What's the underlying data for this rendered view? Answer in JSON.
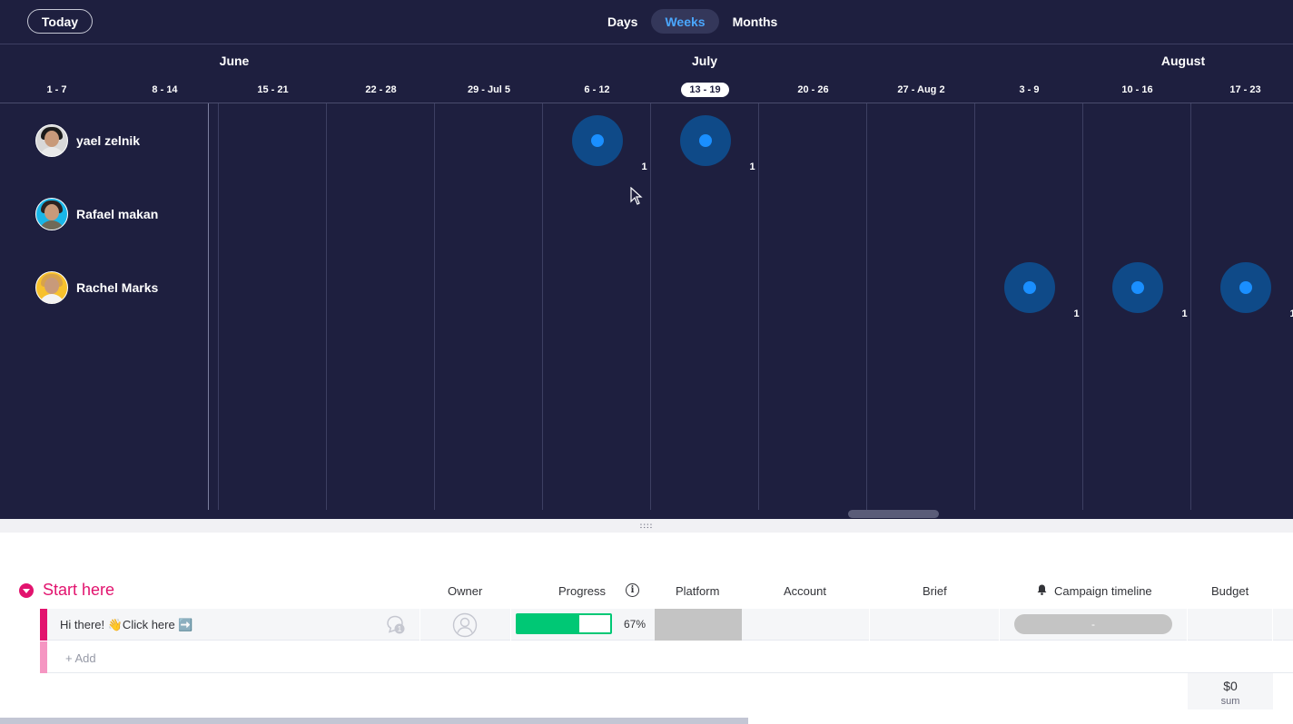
{
  "toolbar": {
    "today_label": "Today",
    "scales": [
      {
        "label": "Days",
        "active": false
      },
      {
        "label": "Weeks",
        "active": true
      },
      {
        "label": "Months",
        "active": false
      }
    ]
  },
  "months": [
    "June",
    "July",
    "August"
  ],
  "weeks": [
    "1 - 7",
    "8 - 14",
    "15 - 21",
    "22 - 28",
    "29 - Jul 5",
    "6 - 12",
    "13 - 19",
    "20 - 26",
    "27 - Aug 2",
    "3 - 9",
    "10 - 16",
    "17 - 23"
  ],
  "current_week": "13 - 19",
  "people": [
    {
      "name": "yael zelnik",
      "avatar": "avatar-woman-dark-hair",
      "hair": "#1b1b1b",
      "shirt": "#e9e9e9",
      "bg": "#d8d8d8"
    },
    {
      "name": "Rafael makan",
      "avatar": "avatar-man-beard",
      "hair": "#2b2220",
      "shirt": "#6f6a58",
      "bg": "#19b6e8"
    },
    {
      "name": "Rachel Marks",
      "avatar": "avatar-woman-blonde",
      "hair": "#d8a34a",
      "shirt": "#f3f3f3",
      "bg": "#f7c12d"
    }
  ],
  "assignments": [
    {
      "person": "yael zelnik",
      "week": "6 - 12",
      "count": "1"
    },
    {
      "person": "yael zelnik",
      "week": "13 - 19",
      "count": "1"
    },
    {
      "person": "Rachel Marks",
      "week": "3 - 9",
      "count": "1"
    },
    {
      "person": "Rachel Marks",
      "week": "10 - 16",
      "count": "1"
    },
    {
      "person": "Rachel Marks",
      "week": "17 - 23",
      "count": "1"
    }
  ],
  "colors": {
    "timeline_bg": "#1e1f3f",
    "bubble": "#0f4a88",
    "bubble_dot": "#1a8fff",
    "active_tab_text": "#4aa7ff",
    "group_color": "#e2136e",
    "progress_green": "#00c875"
  },
  "board": {
    "group_title": "Start here",
    "columns": {
      "owner": "Owner",
      "progress": "Progress",
      "platform": "Platform",
      "account": "Account",
      "brief": "Brief",
      "campaign_timeline": "Campaign timeline",
      "budget": "Budget"
    },
    "icons": {
      "info": "info-icon",
      "bell": "bell-icon",
      "chat": "chat-bubble-icon",
      "owner": "person-icon"
    },
    "item": {
      "name": "Hi there! 👋Click here ➡️",
      "updates_count": "1",
      "progress_fraction": 0.67,
      "progress_text": "67%",
      "timeline_value": "-"
    },
    "add_label": "+ Add",
    "budget_sum": "$0",
    "budget_sum_label": "sum"
  }
}
